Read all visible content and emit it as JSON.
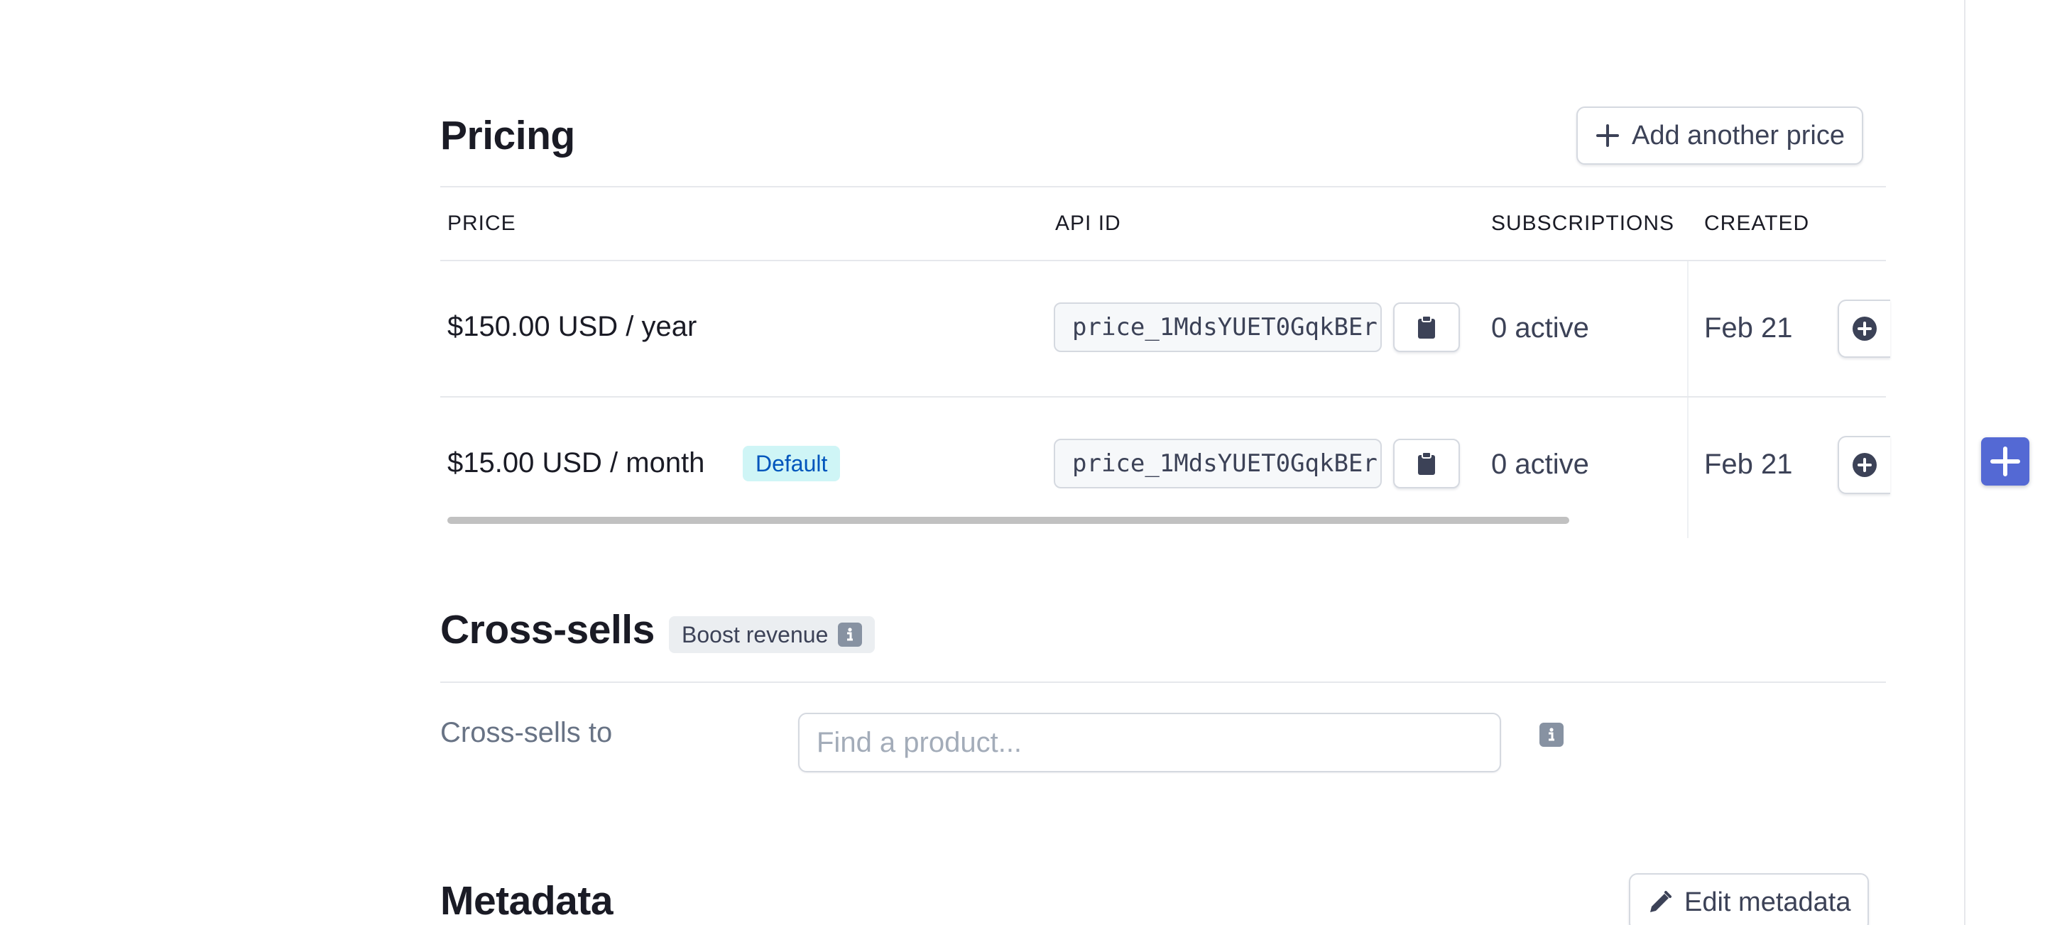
{
  "pricing": {
    "title": "Pricing",
    "add_price_label": "Add another price",
    "columns": [
      "PRICE",
      "API ID",
      "SUBSCRIPTIONS",
      "CREATED"
    ],
    "rows": [
      {
        "price": "$150.00 USD / year",
        "badge": "",
        "api_id": "price_1MdsYUET0GqkBEr",
        "subscriptions": "0 active",
        "created": "Feb 21"
      },
      {
        "price": "$15.00 USD / month",
        "badge": "Default",
        "api_id": "price_1MdsYUET0GqkBEr",
        "subscriptions": "0 active",
        "created": "Feb 21"
      }
    ]
  },
  "cross_sells": {
    "title": "Cross-sells",
    "badge": "Boost revenue",
    "field_label": "Cross-sells to",
    "search_placeholder": "Find a product..."
  },
  "metadata": {
    "title": "Metadata",
    "edit_label": "Edit metadata"
  },
  "colors": {
    "accent": "#5469d4",
    "default_badge_bg": "#cff5f6",
    "default_badge_text": "#0055bc"
  },
  "icons": {
    "add_price": "plus-icon",
    "copy": "clipboard-icon",
    "row_action": "plus-circle-icon",
    "info": "info-icon",
    "edit": "pencil-icon",
    "fab": "plus-icon"
  }
}
